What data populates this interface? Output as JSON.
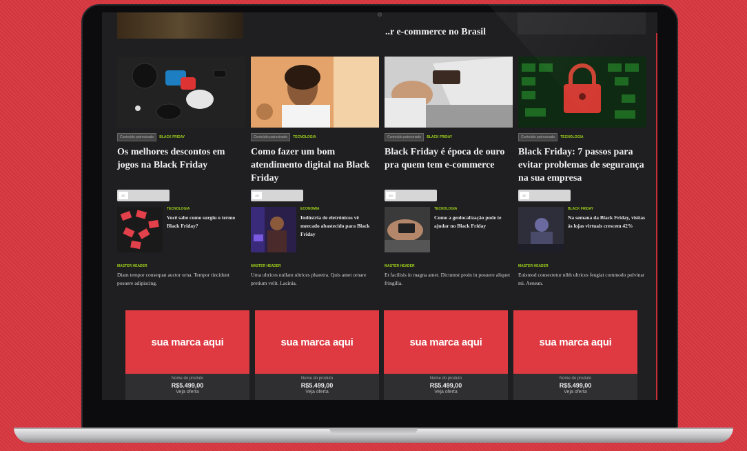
{
  "top_row": {
    "title": "..r e-commerce no Brasil"
  },
  "articles": [
    {
      "tag_sponsored": "Conteúdo patrocinado",
      "category": "BLACK FRIDAY",
      "title": "Os melhores descontos em jogos na Black Friday",
      "pill": "AD"
    },
    {
      "tag_sponsored": "Conteúdo patrocinado",
      "category": "TECNOLOGIA",
      "title": "Como fazer um bom atendimento digital na Black Friday",
      "pill": "AD"
    },
    {
      "tag_sponsored": "Conteúdo patrocinado",
      "category": "BLACK FRIDAY",
      "title": "Black Friday é época de ouro pra quem tem e-commerce",
      "pill": "AD"
    },
    {
      "tag_sponsored": "Conteúdo patrocinado",
      "category": "TECNOLOGIA",
      "title": "Black Friday: 7 passos para evitar problemas de segurança na sua empresa",
      "pill": "AD"
    }
  ],
  "small_items": [
    {
      "category": "TECNOLOGIA",
      "text": "Você sabe como surgiu o termo Black Friday?"
    },
    {
      "category": "ECONOMIA",
      "text": "Indústria de eletrônicos vê mercado abastecido para Black Friday"
    },
    {
      "category": "TECNOLOGIA",
      "text": "Como a geolocalização pode te ajudar no Black Friday"
    },
    {
      "category": "BLACK FRIDAY",
      "text": "Na semana da Black Friday, visitas às lojas virtuais crescem 42%"
    }
  ],
  "master_items": [
    {
      "category": "MASTER HEADER",
      "text": "Diam tempor consequat auctor urna. Tempor tincidunt posuere adipiscing."
    },
    {
      "category": "MASTER HEADER",
      "text": "Urna ultrices nullam ultrices pharetra. Quis amet ornare pretium velit. Lacinia."
    },
    {
      "category": "MASTER HEADER",
      "text": "Et facilisis in magna amet. Dictumst proin in posuere aliquet fringilla."
    },
    {
      "category": "MASTER HEADER",
      "text": "Euismod consectetur nibh ultrices feugiat commodo pulvinar mi. Aenean."
    }
  ],
  "brands": [
    {
      "label": "sua marca aqui",
      "product": "Nome do produto",
      "price": "R$5.499,00",
      "offer": "Veja oferta"
    },
    {
      "label": "sua marca aqui",
      "product": "Nome do produto",
      "price": "R$5.499,00",
      "offer": "Veja oferta"
    },
    {
      "label": "sua marca aqui",
      "product": "Nome do produto",
      "price": "R$5.499,00",
      "offer": "Veja oferta"
    },
    {
      "label": "sua marca aqui",
      "product": "Nome do produto",
      "price": "R$5.499,00",
      "offer": "Veja oferta"
    }
  ],
  "colors": {
    "background": "#d8373f",
    "accent": "#9fd11a",
    "brand": "#df3a42"
  }
}
